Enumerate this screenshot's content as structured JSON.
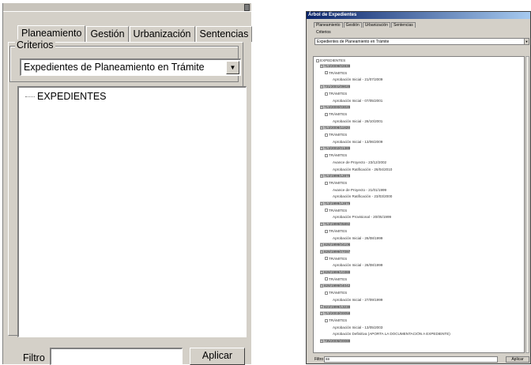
{
  "left_panel": {
    "tabs": [
      "Planeamiento",
      "Gestión",
      "Urbanización",
      "Sentencias"
    ],
    "group_label": "Criterios",
    "criteria_value": "Expedientes de Planeamiento en Trámite",
    "tree_root": "EXPEDIENTES",
    "filter_label": "Filtro",
    "filter_value": "",
    "apply_label": "Aplicar"
  },
  "right_window": {
    "title": "Árbol de Expedientes",
    "tabs": [
      "Planeamiento",
      "Gestión",
      "Urbanización",
      "Sentencias"
    ],
    "group_label": "Criterios",
    "criteria_value": "Expedientes de Planeamiento en Trámite",
    "tree_root": "EXPEDIENTES",
    "filter_label": "Filtro",
    "filter_value": "ss",
    "apply_label": "Aplicar",
    "tree": [
      {
        "text": "713/2009/02838",
        "kind": "code",
        "level": 1
      },
      {
        "text": "TRÁMITES",
        "kind": "folder",
        "level": 2
      },
      {
        "text": "Aprobación Inicial - 21/07/2009",
        "kind": "leaf",
        "level": 3
      },
      {
        "text": "731/2001/09028",
        "kind": "code",
        "level": 1
      },
      {
        "text": "TRÁMITES",
        "kind": "folder",
        "level": 2
      },
      {
        "text": "Aprobación Inicial - 07/05/2001",
        "kind": "leaf",
        "level": 3
      },
      {
        "text": "713/2000/03028",
        "kind": "code",
        "level": 1
      },
      {
        "text": "TRÁMITES",
        "kind": "folder",
        "level": 2
      },
      {
        "text": "Aprobación Inicial - 26/10/2001",
        "kind": "leaf",
        "level": 3
      },
      {
        "text": "713/2008/11828",
        "kind": "code",
        "level": 1
      },
      {
        "text": "TRÁMITES",
        "kind": "folder",
        "level": 2
      },
      {
        "text": "Aprobación Inicial - 13/06/2009",
        "kind": "leaf",
        "level": 3
      },
      {
        "text": "713/2002/01389",
        "kind": "code",
        "level": 1
      },
      {
        "text": "TRÁMITES",
        "kind": "folder",
        "level": 2
      },
      {
        "text": "Avance de Proyecto - 23/12/2002",
        "kind": "leaf",
        "level": 3
      },
      {
        "text": "Aprobación Ratificación - 26/04/2010",
        "kind": "leaf",
        "level": 3
      },
      {
        "text": "713/1999/12878",
        "kind": "code",
        "level": 1
      },
      {
        "text": "TRÁMITES",
        "kind": "folder",
        "level": 2
      },
      {
        "text": "Avance de Proyecto - 21/01/1999",
        "kind": "leaf",
        "level": 3
      },
      {
        "text": "Aprobación Ratificación - 23/03/2000",
        "kind": "leaf",
        "level": 3
      },
      {
        "text": "713/1999/12879",
        "kind": "code",
        "level": 1
      },
      {
        "text": "TRÁMITES",
        "kind": "folder",
        "level": 2
      },
      {
        "text": "Aprobación Provisional - 20/05/1999",
        "kind": "leaf",
        "level": 3
      },
      {
        "text": "713/1999/05892",
        "kind": "code",
        "level": 1
      },
      {
        "text": "TRÁMITES",
        "kind": "folder",
        "level": 2
      },
      {
        "text": "Aprobación Inicial - 26/08/1999",
        "kind": "leaf",
        "level": 3
      },
      {
        "text": "828/1999/04106",
        "kind": "code",
        "level": 1
      },
      {
        "text": "828/1999/07097",
        "kind": "code",
        "level": 1
      },
      {
        "text": "TRÁMITES",
        "kind": "folder",
        "level": 2
      },
      {
        "text": "Aprobación Inicial - 26/08/1999",
        "kind": "leaf",
        "level": 3
      },
      {
        "text": "828/1999/10388",
        "kind": "code",
        "level": 1
      },
      {
        "text": "TRÁMITES",
        "kind": "folder",
        "level": 2
      },
      {
        "text": "828/1999/04042",
        "kind": "code",
        "level": 1
      },
      {
        "text": "TRÁMITES",
        "kind": "folder",
        "level": 2
      },
      {
        "text": "Aprobación Inicial - 27/09/1999",
        "kind": "leaf",
        "level": 3
      },
      {
        "text": "823/1999/13238",
        "kind": "code",
        "level": 1
      },
      {
        "text": "713/2003/00058",
        "kind": "code",
        "level": 1
      },
      {
        "text": "TRÁMITES",
        "kind": "folder",
        "level": 2
      },
      {
        "text": "Aprobación Inicial - 13/05/2003",
        "kind": "leaf",
        "level": 3
      },
      {
        "text": "Aprobación Definitiva (APORTA LA DOCUMENTACIÓN A EXPEDIENTE)",
        "kind": "leaf",
        "level": 3
      },
      {
        "text": "735/2005/00088",
        "kind": "code",
        "level": 1
      }
    ]
  }
}
